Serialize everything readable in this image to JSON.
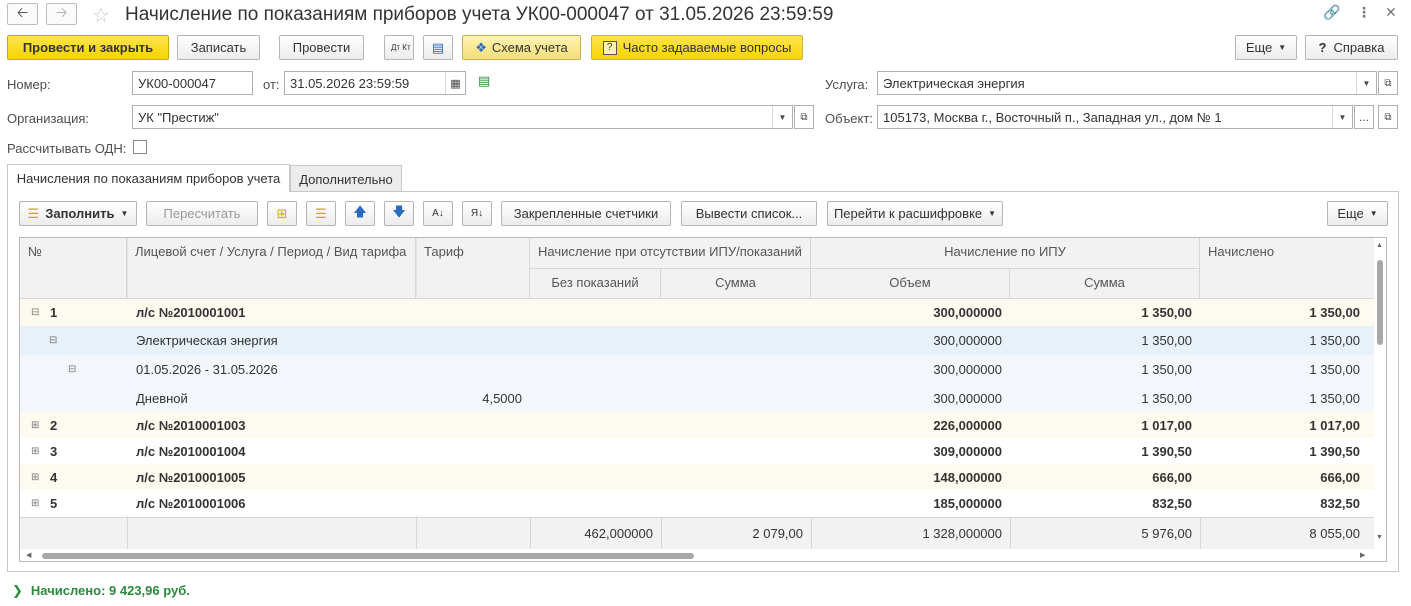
{
  "window": {
    "title": "Начисление по показаниям приборов учета УК00-000047 от 31.05.2026 23:59:59"
  },
  "toolbar": {
    "post_close": "Провести и закрыть",
    "save": "Записать",
    "post": "Провести",
    "dt_kt": "Дт Кт",
    "scheme": "Схема учета",
    "faq": "Часто задаваемые вопросы",
    "more": "Еще",
    "help": "Справка"
  },
  "form": {
    "number_label": "Номер:",
    "number_value": "УК00-000047",
    "date_label": "от:",
    "date_value": "31.05.2026 23:59:59",
    "org_label": "Организация:",
    "org_value": "УК \"Престиж\"",
    "odn_label": "Рассчитывать ОДН:",
    "odn_checked": false,
    "service_label": "Услуга:",
    "service_value": "Электрическая энергия",
    "object_label": "Объект:",
    "object_value": "105173, Москва г., Восточный п., Западная ул., дом № 1"
  },
  "tabs": [
    {
      "label": "Начисления по показаниям приборов учета",
      "active": true
    },
    {
      "label": "Дополнительно",
      "active": false
    }
  ],
  "table_toolbar": {
    "fill": "Заполнить",
    "recalc": "Пересчитать",
    "pinned": "Закрепленные счетчики",
    "output_list": "Вывести список...",
    "goto_details": "Перейти к расшифровке",
    "more": "Еще"
  },
  "table": {
    "headers": {
      "num": "№",
      "account": "Лицевой счет / Услуга / Период / Вид тарифа",
      "tariff": "Тариф",
      "no_ipu_group": "Начисление при отсутствии ИПУ/показаний",
      "no_readings": "Без показаний",
      "no_ipu_sum": "Сумма",
      "ipu_group": "Начисление по ИПУ",
      "ipu_volume": "Объем",
      "ipu_sum": "Сумма",
      "charged": "Начислено"
    },
    "rows": [
      {
        "num": "1",
        "text": "л/с №2010001001",
        "tariff": "",
        "volume": "300,000000",
        "sum": "1 350,00",
        "charged": "1 350,00"
      },
      {
        "num": "",
        "text": "Электрическая энергия",
        "tariff": "",
        "volume": "300,000000",
        "sum": "1 350,00",
        "charged": "1 350,00"
      },
      {
        "num": "",
        "text": "01.05.2026 - 31.05.2026",
        "tariff": "",
        "volume": "300,000000",
        "sum": "1 350,00",
        "charged": "1 350,00"
      },
      {
        "num": "",
        "text": "Дневной",
        "tariff": "4,5000",
        "volume": "300,000000",
        "sum": "1 350,00",
        "charged": "1 350,00"
      },
      {
        "num": "2",
        "text": "л/с №2010001003",
        "tariff": "",
        "volume": "226,000000",
        "sum": "1 017,00",
        "charged": "1 017,00"
      },
      {
        "num": "3",
        "text": "л/с №2010001004",
        "tariff": "",
        "volume": "309,000000",
        "sum": "1 390,50",
        "charged": "1 390,50"
      },
      {
        "num": "4",
        "text": "л/с №2010001005",
        "tariff": "",
        "volume": "148,000000",
        "sum": "666,00",
        "charged": "666,00"
      },
      {
        "num": "5",
        "text": "л/с №2010001006",
        "tariff": "",
        "volume": "185,000000",
        "sum": "832,50",
        "charged": "832,50"
      }
    ],
    "footer": {
      "no_readings": "462,000000",
      "no_ipu_sum": "2 079,00",
      "ipu_volume": "1 328,000000",
      "ipu_sum": "5 976,00",
      "charged": "8 055,00"
    }
  },
  "summary": "Начислено: 9 423,96 руб.",
  "colors": {
    "primary_button": "#f6d400",
    "group_row": "#fdfaf0",
    "selected_row": "#e8f0fa",
    "sub_row": "#f3f7fc",
    "summary_text": "#2b8a3e"
  }
}
